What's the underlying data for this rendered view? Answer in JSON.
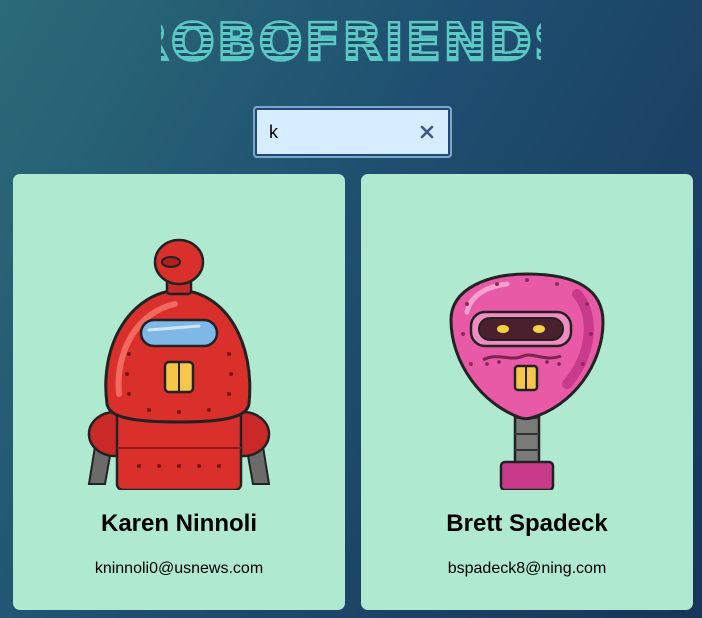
{
  "header": {
    "title": "ROBOFRIENDS",
    "title_color": "#5cc8c4"
  },
  "search": {
    "value": "k",
    "placeholder": "",
    "clear_icon": "close-icon",
    "clear_color": "#3a5a8a"
  },
  "robots": [
    {
      "name": "Karen Ninnoli",
      "email": "kninnoli0@usnews.com",
      "image_icon": "red-robot-avatar",
      "color": "#d9302b"
    },
    {
      "name": "Brett Spadeck",
      "email": "bspadeck8@ning.com",
      "image_icon": "pink-robot-avatar",
      "color": "#e85aa6"
    }
  ],
  "colors": {
    "card_bg": "#aee9d0",
    "bg_start": "#2b6b78",
    "bg_end": "#173559"
  }
}
